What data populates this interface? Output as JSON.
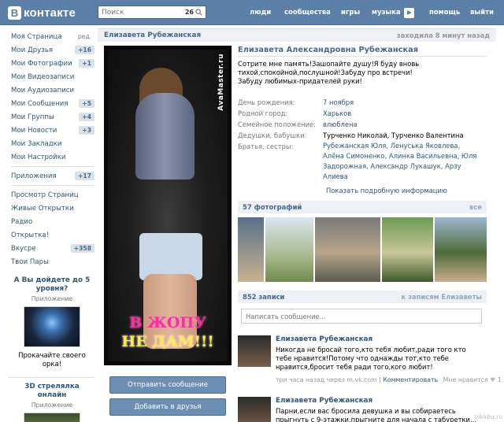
{
  "header": {
    "logo_letter": "В",
    "logo_text": "контакте",
    "search_placeholder": "Поиск",
    "search_count": "26",
    "nav": [
      "люди",
      "сообщества",
      "игры",
      "музыка",
      "помощь",
      "выйти"
    ]
  },
  "sidebar": {
    "items": [
      {
        "label": "Моя Страница",
        "badge": "ред.",
        "plain": true
      },
      {
        "label": "Мои Друзья",
        "badge": "+16"
      },
      {
        "label": "Мои Фотографии",
        "badge": "+1"
      },
      {
        "label": "Мои Видеозаписи",
        "badge": ""
      },
      {
        "label": "Мои Аудиозаписи",
        "badge": ""
      },
      {
        "label": "Мои Сообщения",
        "badge": "+5"
      },
      {
        "label": "Мои Группы",
        "badge": "+4"
      },
      {
        "label": "Мои Новости",
        "badge": "+3"
      },
      {
        "label": "Мои Закладки",
        "badge": ""
      },
      {
        "label": "Мои Настройки",
        "badge": ""
      }
    ],
    "apps": {
      "label": "Приложения",
      "badge": "+17"
    },
    "extra": [
      {
        "label": "Просмотр Страниц",
        "badge": ""
      },
      {
        "label": "Живые Открытки",
        "badge": ""
      },
      {
        "label": "Радио",
        "badge": ""
      },
      {
        "label": "Открытка!",
        "badge": ""
      },
      {
        "label": "Вкусре",
        "badge": "+358"
      },
      {
        "label": "Твои Пары",
        "badge": ""
      }
    ],
    "ad1": {
      "title": "А Вы дойдете до 5 уровня?",
      "sub": "Приложение",
      "desc": "Прокачайте своего орка!"
    },
    "ad2": {
      "title": "3D стрелялка онлайн",
      "sub": "Приложение"
    }
  },
  "profile": {
    "short_name": "Елизавета Рубежанская",
    "last_seen": "заходила 8 минут назад",
    "full_name": "Елизавета Александровна Рубежанская",
    "status": "Сотрите мне память!Зашопайте душу!Я буду вновь тихой,спокойной,послушной!Забуду про встречи!Забуду любимых-придателей руки!",
    "photo_watermark": "AvaMaster.ru",
    "photo_caption_1": "В ЖОПУ",
    "photo_caption_2": "НЕ ДАМ!!!",
    "send_message": "Отправить сообщение",
    "add_friend": "Добавить в друзья",
    "info": [
      {
        "k": "День рождения:",
        "v": "7 ноября",
        "link": true
      },
      {
        "k": "Родной город:",
        "v": "Харьков",
        "link": true
      },
      {
        "k": "Семейное положение:",
        "v": "влюблена",
        "link": true
      },
      {
        "k": "Дедушки, бабушки:",
        "v": "Турченко Николай, Турченко Валентина",
        "link": false
      },
      {
        "k": "Братья, сестры:",
        "v": "Рубежанская Юля, Ленуська Яковлева, Алёна Симоненко, Алинка Васильевна, Юля Задорожная, Александр Лукашук, Арзу Алиева",
        "link": true
      }
    ],
    "show_more": "Показать подробную информацию"
  },
  "photos_section": {
    "title": "57 фотографий",
    "action": "все"
  },
  "wall": {
    "title": "852 записи",
    "action": "к записям Елизаветы",
    "placeholder": "Написать сообщение...",
    "posts": [
      {
        "author": "Елизавета Рубежанская",
        "text": "Никогда не бросай того,кто тебя любит,ради того кто тебе нравится!Потому что однажды тот,кто тебе нравится,бросит тебя ради того,кого любит!",
        "time": "три часа назад через m.vk.com",
        "comment": "Комментировать",
        "like": "Мне нравится",
        "like_count": "1"
      },
      {
        "author": "Елизавета Рубежанская",
        "text": "Парни,если вас бросила девушка и вы собираетесь прыгнуть с 9-этажки,прыгните для начала с табуретки...",
        "time": "",
        "comment": "",
        "like": "",
        "like_count": ""
      }
    ]
  },
  "site_mark": "pikabu.ru"
}
